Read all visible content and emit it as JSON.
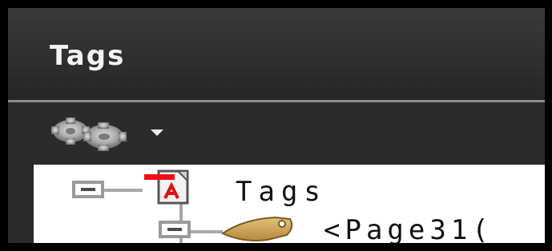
{
  "panel": {
    "title": "Tags"
  },
  "toolbar": {
    "options_icon": "gear-icon",
    "dropdown_icon": "chevron-down-icon"
  },
  "tree": {
    "root": {
      "label": "Tags",
      "icon": "pdf-document-icon",
      "expanded": true
    },
    "children": [
      {
        "label": "<Page31(",
        "icon": "tag-icon",
        "expanded": true
      }
    ]
  }
}
